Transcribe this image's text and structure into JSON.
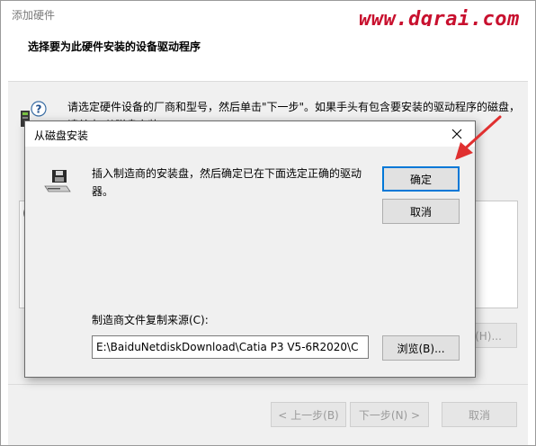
{
  "window": {
    "title": "添加硬件",
    "watermark": "www.dgrai.com",
    "header_title": "选择要为此硬件安装的设备驱动程序",
    "instruction": "请选定硬件设备的厂商和型号，然后单击\"下一步\"。如果手头有包含要安装的驱动程序的磁盘，请单击\"从磁盘安装\"。",
    "list_partial_char": "(",
    "buttons": {
      "have_disk": "安装(H)...",
      "back": "< 上一步(B)",
      "next": "下一步(N) >",
      "cancel": "取消"
    }
  },
  "dialog": {
    "title": "从磁盘安装",
    "message": "插入制造商的安装盘，然后确定已在下面选定正确的驱动器。",
    "ok_label": "确定",
    "cancel_label": "取消",
    "source_label": "制造商文件复制来源(C):",
    "source_value": "E:\\BaiduNetdiskDownload\\Catia P3 V5-6R2020\\C",
    "browse_label": "浏览(B)..."
  },
  "colors": {
    "watermark": "#c8102e",
    "arrow": "#e03030",
    "default_button_border": "#0078d7"
  }
}
